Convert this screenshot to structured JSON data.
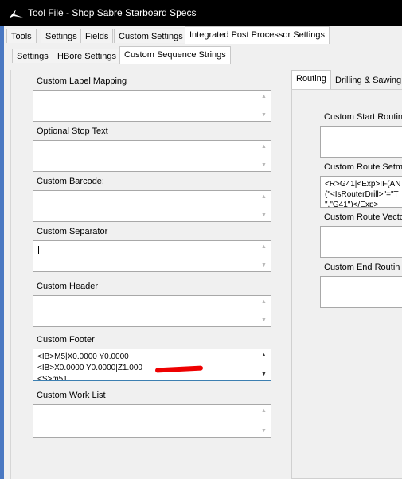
{
  "window": {
    "title": "Tool File - Shop Sabre Starboard Specs"
  },
  "main_tabs": [
    "Tools",
    "Settings",
    "Fields",
    "Custom Settings",
    "Integrated Post Processor Settings"
  ],
  "sub_tabs": [
    "Settings",
    "HBore Settings",
    "Custom Sequence Strings"
  ],
  "fields": {
    "custom_label_mapping": {
      "label": "Custom Label Mapping"
    },
    "optional_stop_text": {
      "label": "Optional Stop Text"
    },
    "custom_barcode": {
      "label": "Custom Barcode:"
    },
    "custom_separator": {
      "label": "Custom Separator"
    },
    "custom_header": {
      "label": "Custom Header"
    },
    "custom_footer": {
      "label": "Custom Footer",
      "line1": "<IB>M5|X0.0000 Y0.0000",
      "line2": "<IB>X0.0000 Y0.0000|Z1.000",
      "line3": "<S>m51"
    },
    "custom_work_list": {
      "label": "Custom Work List"
    }
  },
  "right_tabs": [
    "Routing",
    "Drilling & Sawing"
  ],
  "routing": {
    "custom_start_routing": {
      "label": "Custom Start Routin"
    },
    "custom_route_setm": {
      "label": "Custom Route Setm",
      "line1": "<R>G41|<Exp>IF(AN",
      "line2": "(\"<IsRouterDrill>\"=\"T",
      "line3": "\",\"G41\")</Exp>"
    },
    "custom_route_vector": {
      "label": "Custom Route Vecto"
    },
    "custom_end_routing": {
      "label": "Custom End Routin"
    }
  },
  "colors": {
    "title_bar": "#000000",
    "accent": "#3c7fb1",
    "annotation": "#e00000"
  }
}
